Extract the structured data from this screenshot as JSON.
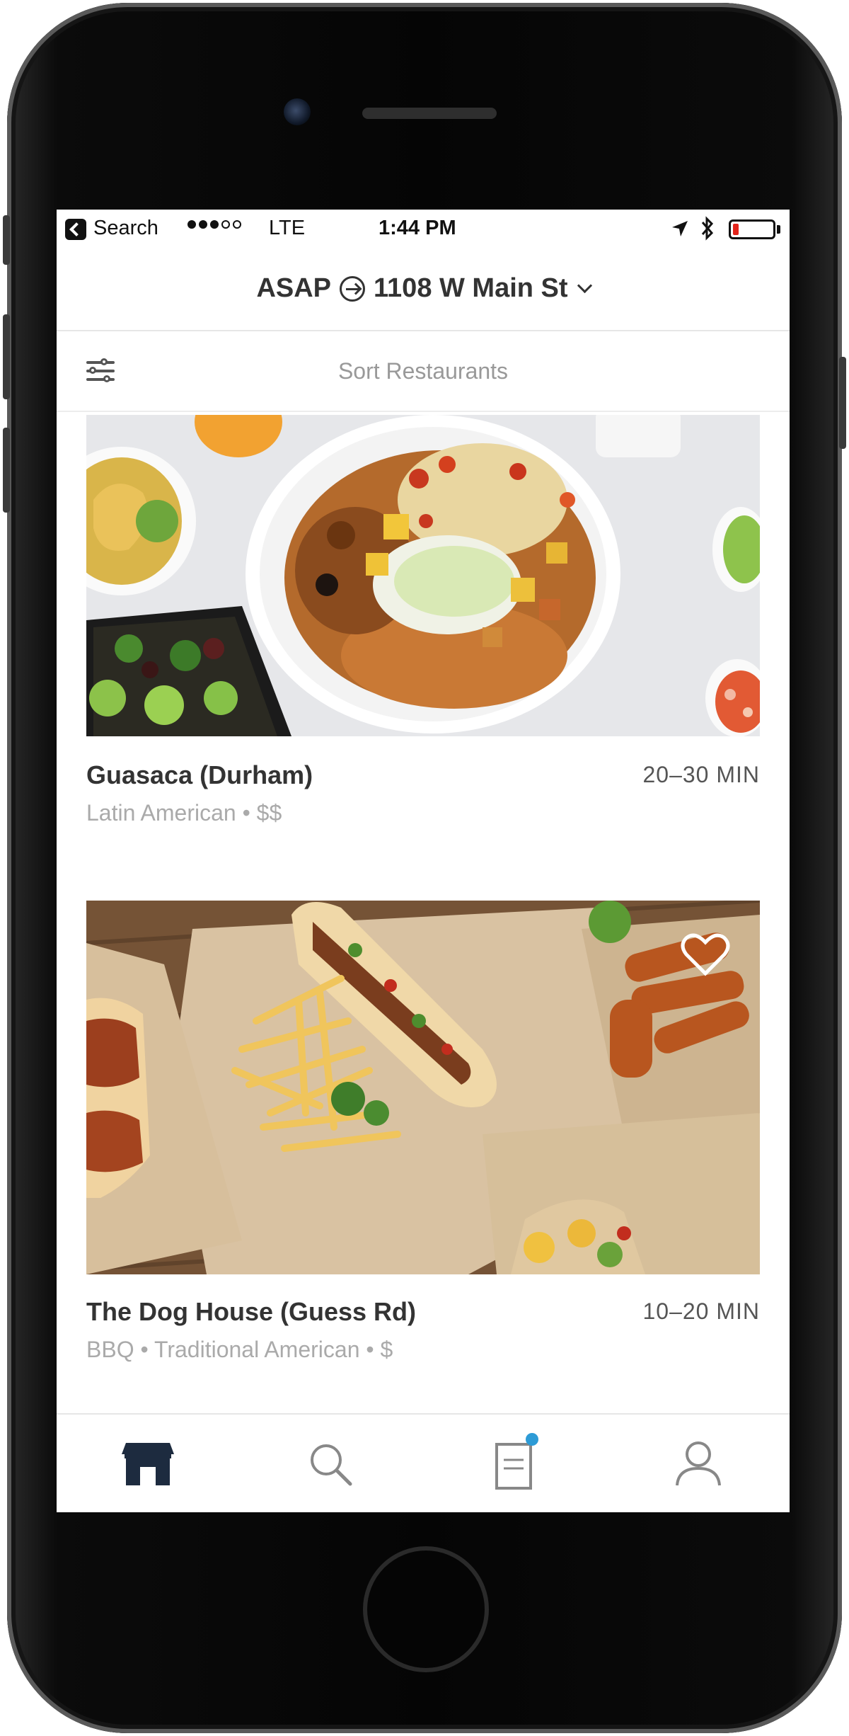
{
  "status_bar": {
    "back_label": "Search",
    "signal_dots_filled": 3,
    "signal_dots_total": 5,
    "carrier": "LTE",
    "time": "1:44 PM",
    "battery_level": 0.15
  },
  "header": {
    "delivery_time": "ASAP",
    "address": "1108 W Main St"
  },
  "sort_bar": {
    "label": "Sort Restaurants"
  },
  "restaurants": [
    {
      "name": "Guasaca (Durham)",
      "delivery_time": "20–30 MIN",
      "details": "Latin American • $$"
    },
    {
      "name": "The Dog House (Guess Rd)",
      "delivery_time": "10–20 MIN",
      "details": "BBQ • Traditional American • $"
    }
  ],
  "tab_bar": {
    "active": "restaurants",
    "has_order_notification": true
  },
  "colors": {
    "accent_dark": "#1d2b3f",
    "notification_dot": "#2d9bd6",
    "battery_low": "#e2231a"
  }
}
